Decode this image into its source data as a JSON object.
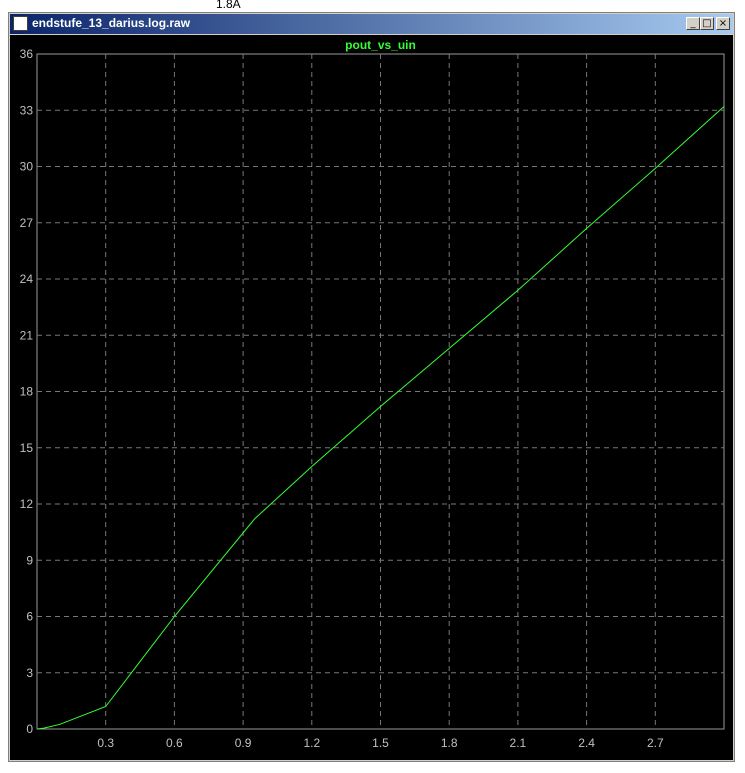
{
  "window": {
    "title": "endstufe_13_darius.log.raw",
    "buttons": {
      "minimize": "_",
      "maximize": "□",
      "close": "×"
    }
  },
  "background": {
    "label": "1.8A"
  },
  "colors": {
    "trace": "#33ff33",
    "title": "#33ff33",
    "grid": "#777777",
    "axis_text": "#c0c0c0",
    "plot_bg": "#000000"
  },
  "chart_data": {
    "type": "line",
    "title": "pout_vs_uin",
    "xlabel": "",
    "ylabel": "",
    "xlim": [
      0,
      3.0
    ],
    "ylim": [
      0,
      36
    ],
    "xticks": [
      "0.3",
      "0.6",
      "0.9",
      "1.2",
      "1.5",
      "1.8",
      "2.1",
      "2.4",
      "2.7"
    ],
    "yticks": [
      "0",
      "3",
      "6",
      "9",
      "12",
      "15",
      "18",
      "21",
      "24",
      "27",
      "30",
      "33",
      "36"
    ],
    "grid": true,
    "series": [
      {
        "x": [
          0,
          0.03,
          0.1,
          0.3,
          0.6,
          0.95,
          1.2,
          1.5,
          1.8,
          2.1,
          2.4,
          2.7,
          3.0
        ],
        "values": [
          0,
          0.05,
          0.25,
          1.2,
          6.0,
          11.2,
          14.0,
          17.2,
          20.3,
          23.4,
          26.7,
          29.9,
          33.2
        ]
      }
    ]
  }
}
